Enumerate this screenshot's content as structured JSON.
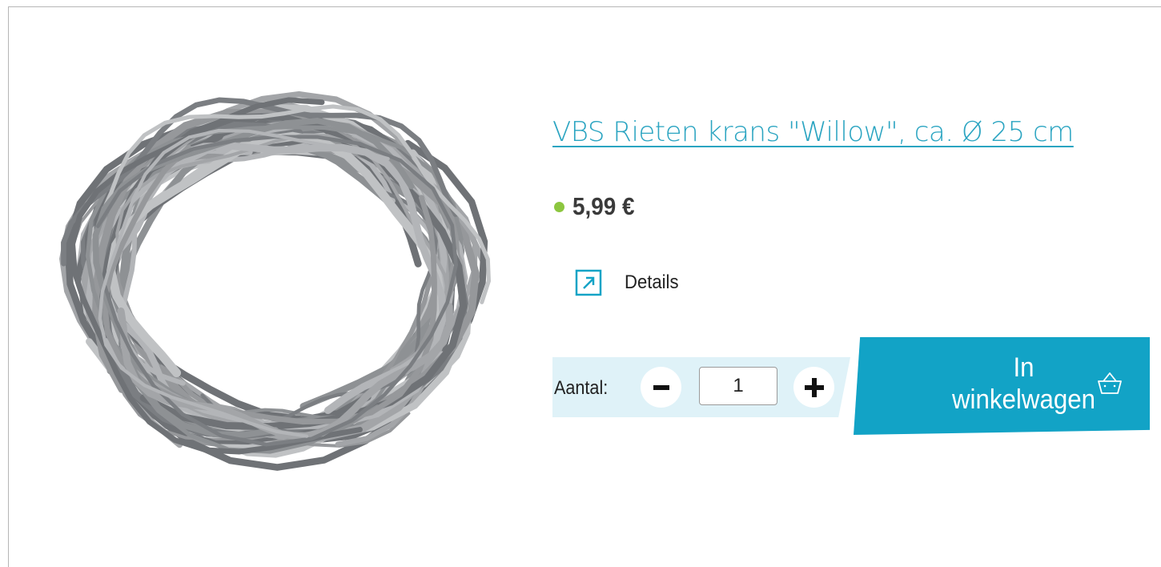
{
  "product": {
    "title": "VBS Rieten krans \"Willow\", ca. Ø 25 cm",
    "price": "5,99 €",
    "availability_color": "#8cc63f",
    "image": "willow-wreath-image",
    "details_label": "Details"
  },
  "quantity": {
    "label": "Aantal:",
    "value": "1"
  },
  "cart": {
    "label_line1": "In",
    "label_line2": "winkelwagen"
  },
  "colors": {
    "accent": "#2aa4c1",
    "button_bg": "#12a3c6",
    "qty_bg": "#dff2f8"
  },
  "icons": {
    "details": "external-link-arrow-icon",
    "minus": "minus-icon",
    "plus": "plus-icon",
    "cart": "basket-icon"
  }
}
